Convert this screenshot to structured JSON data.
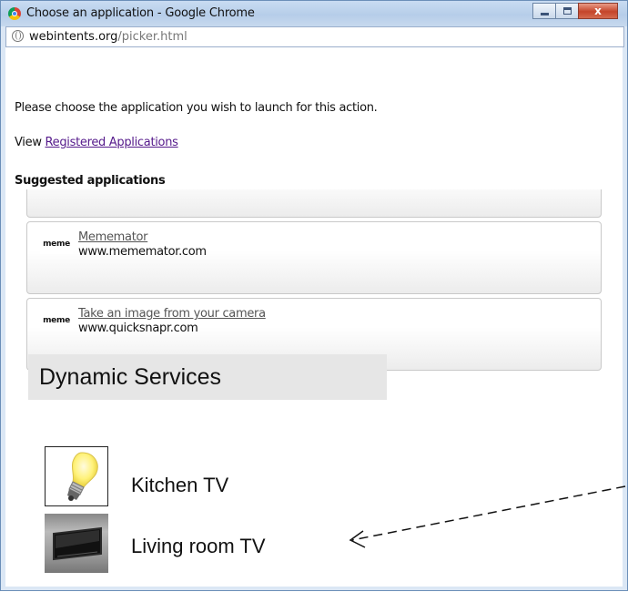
{
  "window": {
    "title": "Choose an application - Google Chrome",
    "close_glyph": "x"
  },
  "address": {
    "host": "webintents.org",
    "path": "/picker.html"
  },
  "page": {
    "instruction": "Please choose the application you wish to launch for this action.",
    "view_prefix": "View ",
    "registered_link": "Registered Applications",
    "suggested_title": "Suggested applications"
  },
  "apps": [
    {
      "logo_text": "meme",
      "name": "Mememator",
      "url": "www.mememator.com"
    },
    {
      "logo_text": "meme",
      "name": "Take an image from your camera",
      "url": "www.quicksnapr.com"
    }
  ],
  "dynamic": {
    "header": "Dynamic Services",
    "devices": [
      {
        "label": "Kitchen TV",
        "icon": "lightbulb-icon"
      },
      {
        "label": "Living room TV",
        "icon": "tv-icon"
      }
    ]
  },
  "colors": {
    "link": "#551a8b",
    "titlebar": "#c9dcf2",
    "close_button": "#c4442a",
    "section_bg": "#e6e6e6"
  }
}
